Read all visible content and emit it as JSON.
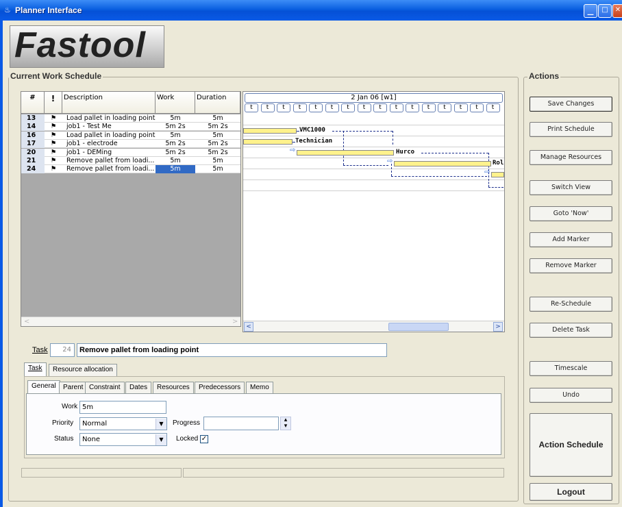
{
  "window": {
    "title": "Planner Interface"
  },
  "logo": {
    "text": "Fastool"
  },
  "schedule": {
    "title": "Current Work Schedule",
    "columns": [
      "#",
      "!",
      "Description",
      "Work",
      "Duration"
    ],
    "rows": [
      {
        "num": "13",
        "pin": "⚑",
        "desc": "Load pallet in loading point",
        "work": "5m",
        "duration": "5m"
      },
      {
        "num": "14",
        "pin": "⚑",
        "desc": "job1 - Test Me",
        "work": "5m 2s",
        "duration": "5m 2s"
      },
      {
        "num": "16",
        "pin": "⚑",
        "desc": "Load pallet in loading point",
        "work": "5m",
        "duration": "5m"
      },
      {
        "num": "17",
        "pin": "⚑",
        "desc": "job1 - electrode",
        "work": "5m 2s",
        "duration": "5m 2s"
      },
      {
        "num": "20",
        "pin": "⚑",
        "desc": "job1 - DEMing",
        "work": "5m 2s",
        "duration": "5m 2s"
      },
      {
        "num": "21",
        "pin": "⚑",
        "desc": "Remove pallet from loadi...",
        "work": "5m",
        "duration": "5m"
      },
      {
        "num": "24",
        "pin": "⚑",
        "desc": "Remove pallet from loadi...",
        "work": "5m",
        "duration": "5m"
      }
    ]
  },
  "gantt": {
    "date_header": "2 Jan 06 [w1]",
    "tick_label": "t",
    "resources": [
      "VMC1000",
      "Technician",
      "Hurco",
      "Rol"
    ]
  },
  "task": {
    "label": "Task",
    "id": "24",
    "name": "Remove pallet from loading point",
    "outer_tabs": [
      "Task",
      "Resource allocation"
    ],
    "inner_tabs": [
      "General",
      "Parent",
      "Constraint",
      "Dates",
      "Resources",
      "Predecessors",
      "Memo"
    ],
    "work_label": "Work",
    "work_value": "5m",
    "priority_label": "Priority",
    "priority_value": "Normal",
    "progress_label": "Progress",
    "progress_value": "",
    "status_label": "Status",
    "status_value": "None",
    "locked_label": "Locked",
    "locked": "✓"
  },
  "actions": {
    "title": "Actions",
    "buttons": [
      "Save Changes",
      "Print Schedule",
      "Manage Resources",
      "Switch View",
      "Goto 'Now'",
      "Add Marker",
      "Remove Marker",
      "Re-Schedule",
      "Delete Task",
      "Timescale",
      "Undo"
    ],
    "action_schedule": "Action Schedule",
    "logout": "Logout"
  }
}
